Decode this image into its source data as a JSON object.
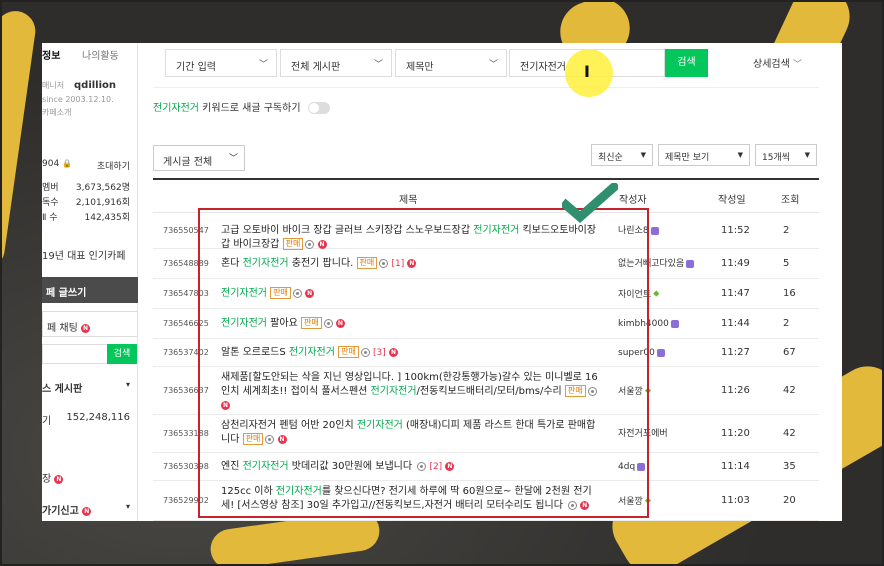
{
  "sidebar": {
    "tab_info": "정보",
    "tab_activity": "나의활동",
    "manager_label": "매니저",
    "manager_name": "qdillion",
    "since": "since 2003.12.10.",
    "cafe_intro": "카페소개",
    "stat_num": "904",
    "invite": "초대하기",
    "members_label": "멤버",
    "members_value": "3,673,562명",
    "stat2_label": "독수",
    "stat2_value": "2,101,916회",
    "stat3_label": "Ⅱ 수",
    "stat3_value": "142,435회",
    "popular": "19년 대표 인기카페",
    "write": "페 글쓰기",
    "chat": "페 채팅",
    "search_btn": "검색",
    "board_title": "스 게시판",
    "board_row_label": "기",
    "board_row_value": "152,248,116",
    "item_jang": "장",
    "report": "가기신고"
  },
  "search": {
    "period": "기간 입력",
    "board": "전체 게시판",
    "scope": "제목만",
    "query": "전기자전거",
    "button": "검색",
    "detail": "상세검색"
  },
  "subscribe": {
    "keyword": "전기자전거",
    "text": " 키워드로 새글 구독하기"
  },
  "filters": {
    "post_type": "게시글 전체",
    "sort": "최신순",
    "view": "제목만 보기",
    "count": "15개씩"
  },
  "table": {
    "headers": {
      "title": "제목",
      "author": "작성자",
      "date": "작성일",
      "views": "조회"
    },
    "rows": [
      {
        "id": "736550547",
        "title_pre": "고급 오토바이 바이크 장갑 글러브 스키장갑 스노우보드장갑 ",
        "kw": "전기자전거",
        "title_post": " 킥보드오토바이장갑 바이크장갑",
        "sale": "판매",
        "count": "",
        "author": "나린소8",
        "date": "11:52",
        "views": "2"
      },
      {
        "id": "736548889",
        "title_pre": "혼다 ",
        "kw": "전기자전거",
        "title_post": " 충전기 팝니다.",
        "sale": "판매",
        "count": "[1]",
        "author": "없는거빼고다있음",
        "date": "11:49",
        "views": "5"
      },
      {
        "id": "736547803",
        "title_pre": "",
        "kw": "전기자전거",
        "title_post": "",
        "sale": "판매",
        "count": "",
        "author": "자이언트",
        "date": "11:47",
        "views": "16"
      },
      {
        "id": "736546625",
        "title_pre": "",
        "kw": "전기자전거",
        "title_post": " 팔아요",
        "sale": "판매",
        "count": "",
        "author": "kimbh4000",
        "date": "11:44",
        "views": "2"
      },
      {
        "id": "736537402",
        "title_pre": "알톤 오르로드S ",
        "kw": "전기자전거",
        "title_post": "",
        "sale": "판매",
        "count": "[3]",
        "author": "super00",
        "date": "11:27",
        "views": "67"
      },
      {
        "id": "736536637",
        "title_pre": "새제품[할도안되는 삭을 지닌 영상입니다. ] 100km(한강통행가능)갈수 있는 미니벨로 16인치 세계최초!! 접이식 풀서스펜션 ",
        "kw": "전기자전거",
        "title_post": "/전동킥보드배터리/모터/bms/수리",
        "sale": "판매",
        "count": "",
        "author": "서울깡",
        "date": "11:26",
        "views": "42"
      },
      {
        "id": "736533188",
        "title_pre": "삼천리자전거 펜텀 어반 20인치 ",
        "kw": "전기자전거",
        "title_post": " (매장내)디피 제품 라스트 한대 특가로 판매합니다",
        "sale": "판매",
        "count": "",
        "author": "자전거포에버",
        "date": "11:20",
        "views": "42"
      },
      {
        "id": "736530398",
        "title_pre": "엔진 ",
        "kw": "전기자전거",
        "title_post": " 밧데리값 30만원에 보냅니다",
        "sale": "",
        "count": "[2]",
        "author": "4dq",
        "date": "11:14",
        "views": "35"
      },
      {
        "id": "736529902",
        "title_pre": "125cc 이하 ",
        "kw": "전기자전거",
        "title_post": "를 찾으신다면? 전기세 하루에 딱 60원으로~ 한달에 2천원 전기세! [서스영상 참조] 30일 추가입고//전동킥보드,자전거 배터리 모터수리도 됩니다",
        "sale": "",
        "count": "",
        "author": "서울깡",
        "date": "11:03",
        "views": "20"
      }
    ]
  },
  "colors": {
    "accent_green": "#03c75a",
    "keyword_green": "#03a94d",
    "sale_orange": "#e07b00",
    "new_red": "#e8344e",
    "annotation_red": "#c8232c",
    "annotation_check": "#2f8f6f",
    "highlight_yellow": "#fff03c"
  },
  "icons": [
    "chevron-down-icon",
    "camera-icon",
    "new-badge-icon",
    "level-icon",
    "text-cursor-icon",
    "check-mark-icon",
    "lock-icon"
  ]
}
